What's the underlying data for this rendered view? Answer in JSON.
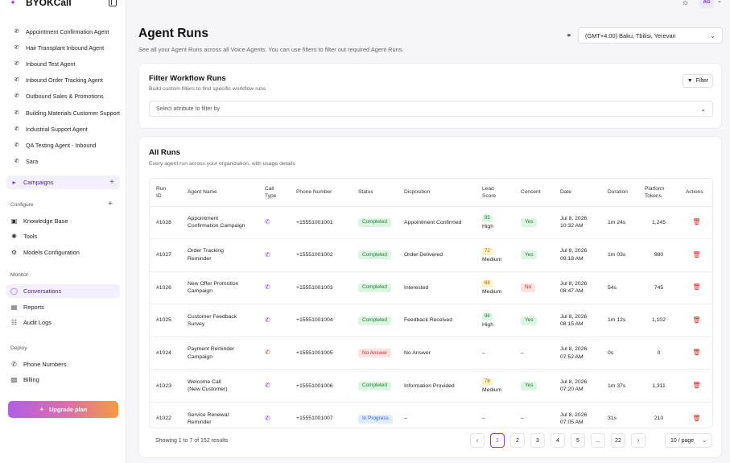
{
  "brand": {
    "name": "BYOKCall"
  },
  "sidebar": {
    "agents": [
      "Appointment Confirmation Agent",
      "Hair Transplant Inbound Agent",
      "Inbound Test Agent",
      "Inbound Order Tracking Agent",
      "Outbound Sales & Promotions",
      "Building Materials Customer Support",
      "Industrial Support Agent",
      "QA Testing Agent - Inbound",
      "Sara"
    ],
    "campaigns_label": "Campaigns",
    "configure_label": "Configure",
    "configure_items": [
      "Knowledge Base",
      "Tools",
      "Models Configuration"
    ],
    "monitor_label": "Monitor",
    "monitor_items": [
      "Conversations",
      "Reports",
      "Audit Logs"
    ],
    "deploy_label": "Deploy",
    "deploy_items": [
      "Phone Numbers",
      "Billing"
    ],
    "upgrade_label": "Upgrade plan"
  },
  "topbar": {
    "avatar_initials": "AG"
  },
  "header": {
    "title": "Agent Runs",
    "subtitle": "See all your Agent Runs across all Voice Agents. You can use filters to filter out required Agent Runs.",
    "timezone": "(GMT+4:00) Baku, Tbilisi, Yerevan"
  },
  "filter_card": {
    "title": "Filter Workflow Runs",
    "subtitle": "Build custom filters to find specific workflow runs",
    "filter_button": "Filter",
    "select_placeholder": "Select attribute to filter by"
  },
  "runs_card": {
    "title": "All Runs",
    "subtitle": "Every agent run across your organization, with usage details",
    "columns": {
      "run_id": [
        "Run",
        "ID"
      ],
      "agent_name": "Agent Name",
      "call_type": [
        "Call",
        "Type"
      ],
      "phone": "Phone Number",
      "status": "Status",
      "disposition": "Disposition",
      "lead_score": [
        "Lead",
        "Score"
      ],
      "consent": "Consent",
      "date": "Date",
      "duration": "Duration",
      "tokens": [
        "Platform",
        "Tokens"
      ],
      "actions": "Actions"
    },
    "rows": [
      {
        "id": "#1028",
        "agent": [
          "Appointment",
          "Confirmation Campaign"
        ],
        "call": "ok",
        "phone": "+15551001001",
        "status": "Completed",
        "status_kind": "green",
        "disposition": "Appointment Confirmed",
        "score": "85",
        "score_kind": "green",
        "score_label": "High",
        "consent": "Yes",
        "consent_kind": "green",
        "date": [
          "Jul 8, 2026",
          "10:32 AM"
        ],
        "duration": "1m 24s",
        "tokens": "1,245"
      },
      {
        "id": "#1027",
        "agent": [
          "Order Tracking",
          "Reminder"
        ],
        "call": "ok",
        "phone": "+15551001002",
        "status": "Completed",
        "status_kind": "green",
        "disposition": "Order Delivered",
        "score": "72",
        "score_kind": "yellow",
        "score_label": "Medium",
        "consent": "Yes",
        "consent_kind": "green",
        "date": [
          "Jul 8, 2026",
          "09:18 AM"
        ],
        "duration": "1m 03s",
        "tokens": "980"
      },
      {
        "id": "#1026",
        "agent": [
          "New Offer Promotion",
          "Campaign"
        ],
        "call": "ok",
        "phone": "+15551001003",
        "status": "Completed",
        "status_kind": "green",
        "disposition": "Interested",
        "score": "68",
        "score_kind": "yellow",
        "score_label": "Medium",
        "consent": "No",
        "consent_kind": "red",
        "date": [
          "Jul 8, 2026",
          "08:47 AM"
        ],
        "duration": "54s",
        "tokens": "745"
      },
      {
        "id": "#1025",
        "agent": [
          "Customer Feedback",
          "Survey"
        ],
        "call": "ok",
        "phone": "+15551001004",
        "status": "Completed",
        "status_kind": "green",
        "disposition": "Feedback Received",
        "score": "96",
        "score_kind": "green",
        "score_label": "High",
        "consent": "Yes",
        "consent_kind": "green",
        "date": [
          "Jul 8, 2026",
          "08:15 AM"
        ],
        "duration": "1m 12s",
        "tokens": "1,102"
      },
      {
        "id": "#1024",
        "agent": [
          "Payment Reminder",
          "Campaign"
        ],
        "call": "missed",
        "phone": "+15551001005",
        "status": "No Answer",
        "status_kind": "red",
        "disposition": "No Answer",
        "score": "",
        "score_kind": "",
        "score_label": "–",
        "consent": "–",
        "consent_kind": "",
        "date": [
          "Jul 8, 2026",
          "07:52 AM"
        ],
        "duration": "0s",
        "tokens": "0"
      },
      {
        "id": "#1023",
        "agent": [
          "Welcome Call",
          "(New Customer)"
        ],
        "call": "ok",
        "phone": "+15551001006",
        "status": "Completed",
        "status_kind": "green",
        "disposition": "Information Provided",
        "score": "78",
        "score_kind": "yellow",
        "score_label": "Medium",
        "consent": "Yes",
        "consent_kind": "green",
        "date": [
          "Jul 8, 2026",
          "07:20 AM"
        ],
        "duration": "1m 37s",
        "tokens": "1,311"
      },
      {
        "id": "#1022",
        "agent": [
          "Service Renewal",
          "Reminder"
        ],
        "call": "ok",
        "phone": "+15551001007",
        "status": "In Progress",
        "status_kind": "blue",
        "disposition": "–",
        "score": "",
        "score_kind": "",
        "score_label": "–",
        "consent": "–",
        "consent_kind": "",
        "date": [
          "Jul 8, 2026",
          "07:05 AM"
        ],
        "duration": "31s",
        "tokens": "210"
      }
    ],
    "showing": "Showing 1 to 7 of 152 results",
    "pages": [
      "1",
      "2",
      "3",
      "4",
      "5",
      "...",
      "22"
    ],
    "current_page": "1",
    "per_page": "10 / page"
  },
  "colors": {
    "accent": "#7c3aed",
    "danger": "#dc2626",
    "success": "#1a7a3a"
  }
}
